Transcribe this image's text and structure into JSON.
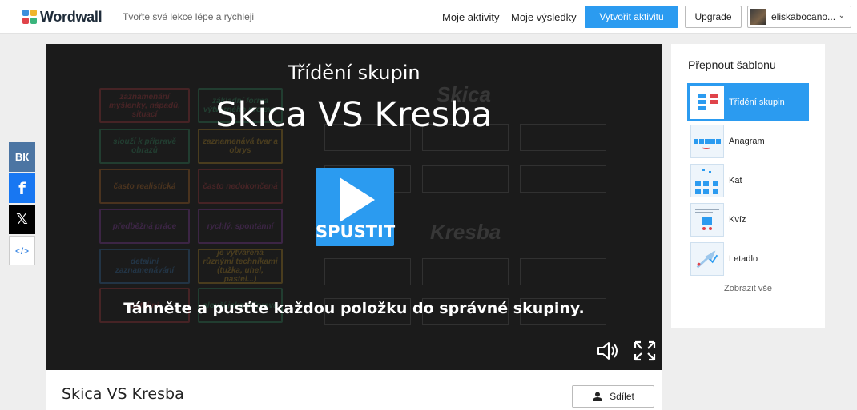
{
  "header": {
    "logo_text": "Wordwall",
    "tagline": "Tvořte své lekce lépe a rychleji",
    "nav": [
      "Moje aktivity",
      "Moje výsledky"
    ],
    "create_label": "Vytvořit aktivitu",
    "upgrade_label": "Upgrade",
    "user_name": "eliskabocano..."
  },
  "share": {
    "vk": "ВК",
    "facebook": "f",
    "x": "𝕏",
    "embed": "</>"
  },
  "game": {
    "template_name": "Třídění skupin",
    "title": "Skica VS Kresba",
    "start_label": "SPUSTIT",
    "instruction": "Táhněte a pusťte každou položku do správné skupiny.",
    "background_cards": [
      "zaznamenání myšlenky, nápadů, situací",
      "základní forma výtvarného projevu",
      "slouží k přípravě obrazů",
      "zaznamenává tvar a obrys",
      "často realistická",
      "často nedokončená",
      "předběžná práce",
      "rychlý, spontánní",
      "detailní zaznamenávání",
      "je vytvářena různými technikami (tužka, uhel, pastel...)",
      "detailní",
      "slouží jako příprava"
    ],
    "background_groups": [
      "Skica",
      "Kresba"
    ]
  },
  "activity": {
    "title": "Skica VS Kresba",
    "share_label": "Sdílet"
  },
  "templates": {
    "title": "Přepnout šablonu",
    "items": [
      {
        "label": "Třídění skupin",
        "active": true
      },
      {
        "label": "Anagram",
        "active": false
      },
      {
        "label": "Kat",
        "active": false
      },
      {
        "label": "Kvíz",
        "active": false
      },
      {
        "label": "Letadlo",
        "active": false
      }
    ],
    "show_all": "Zobrazit vše"
  },
  "colors": {
    "accent": "#2b9bf0",
    "game_bg": "#1b1b1b",
    "page_bg": "#eeeeee"
  }
}
